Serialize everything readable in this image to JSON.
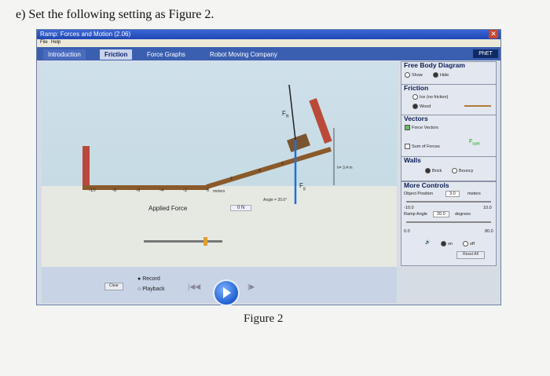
{
  "page": {
    "heading": "e) Set the following setting as Figure 2.",
    "caption": "Figure 2"
  },
  "window": {
    "title": "Ramp: Forces and Motion (2.06)",
    "close_label": "✕",
    "menu": [
      "File",
      "Help"
    ]
  },
  "tabs": [
    {
      "label": "Introduction",
      "active": false
    },
    {
      "label": "Friction",
      "active": true
    },
    {
      "label": "Force Graphs",
      "active": false
    },
    {
      "label": "Robot Moving Company",
      "active": false
    }
  ],
  "phet_logo": "PhET",
  "ruler": {
    "ticks": [
      "-10",
      "-8",
      "-6",
      "-4",
      "-2",
      "0"
    ],
    "unit": "meters"
  },
  "scene": {
    "normal_force": "F",
    "normal_sub": "N",
    "gravity_force": "F",
    "gravity_sub": "g",
    "angle_readout": "Angle = 20.0°",
    "height_readout": "h= 3.4 m",
    "ramp_labels": [
      "2",
      "4",
      "6"
    ]
  },
  "applied_force": {
    "label": "Applied Force",
    "value": "0 N"
  },
  "controls_left": {
    "record": "Record",
    "playback": "Playback",
    "clear": "Clear"
  },
  "right_panel": {
    "fbd": {
      "title": "Free Body Diagram",
      "show": "Show",
      "hide": "Hide",
      "selected": "hide"
    },
    "friction": {
      "title": "Friction",
      "ice": "Ice (no friction)",
      "wood": "Wood",
      "selected": "wood"
    },
    "vectors": {
      "title": "Vectors",
      "force_vectors": "Force Vectors",
      "sum": "Sum of Forces",
      "sum_label": "F",
      "sum_sub": "sum"
    },
    "walls": {
      "title": "Walls",
      "brick": "Brick",
      "bouncy": "Bouncy",
      "selected": "brick"
    },
    "more": {
      "title": "More Controls",
      "object_position_label": "Object Position",
      "object_position_value": "3.0",
      "object_position_unit": "meters",
      "pos_min": "-10.0",
      "pos_max": "10.0",
      "ramp_angle_label": "Ramp Angle",
      "ramp_angle_value": "20.0",
      "ramp_angle_unit": "degrees",
      "angle_min": "0.0",
      "angle_max": "80.0",
      "sound_on": "on",
      "sound_off": "off",
      "reset": "Reset All"
    }
  },
  "colors": {
    "titlebar": "#1f47b3",
    "ramp": "#8a5a2b",
    "wall": "#b94a3a",
    "force": "#1f6fe0"
  }
}
